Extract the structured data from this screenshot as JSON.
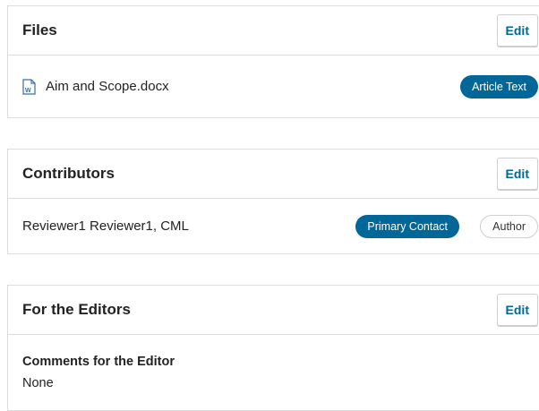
{
  "files": {
    "title": "Files",
    "edit_label": "Edit",
    "items": [
      {
        "name": "Aim and Scope.docx",
        "icon": "word-doc-icon",
        "badge": "Article Text"
      }
    ]
  },
  "contributors": {
    "title": "Contributors",
    "edit_label": "Edit",
    "items": [
      {
        "name": "Reviewer1 Reviewer1, CML",
        "badges": [
          "Primary Contact",
          "Author"
        ]
      }
    ]
  },
  "editors": {
    "title": "For the Editors",
    "edit_label": "Edit",
    "comments_label": "Comments for the Editor",
    "comments_value": "None"
  },
  "colors": {
    "accent": "#006798",
    "border": "#dddddd"
  }
}
